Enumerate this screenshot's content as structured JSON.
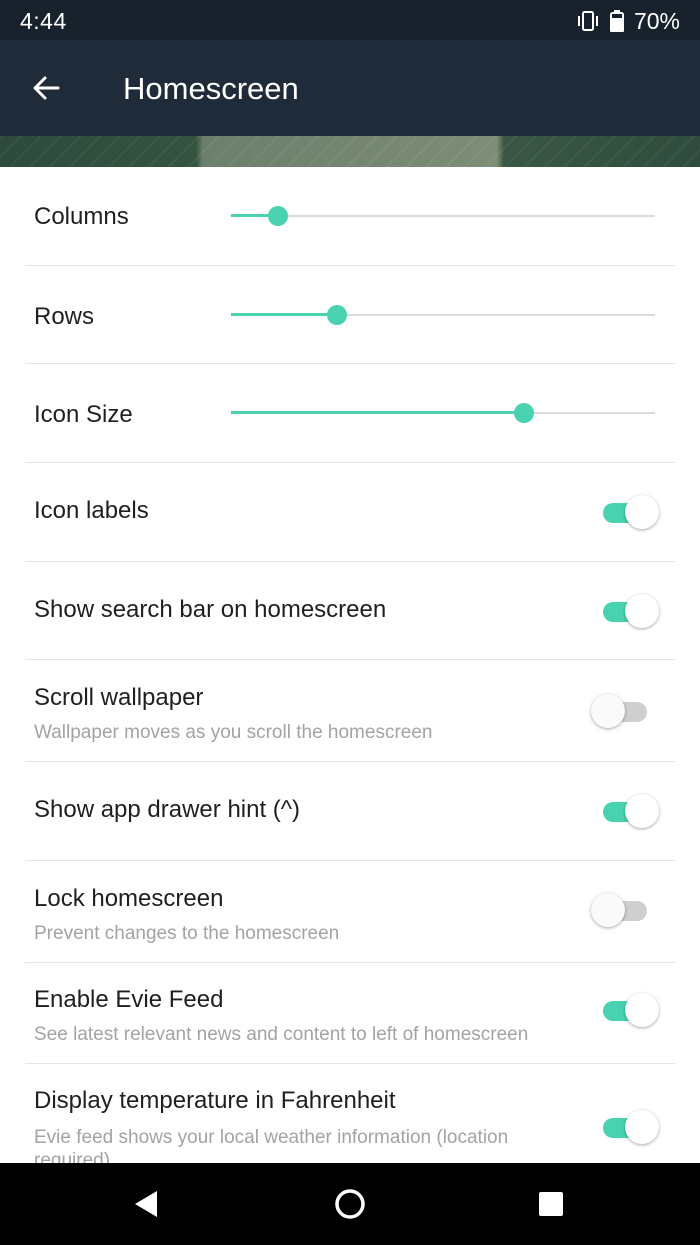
{
  "status_bar": {
    "time": "4:44",
    "battery": "70%",
    "icons": [
      "vibrate-icon",
      "battery-icon"
    ]
  },
  "app_bar": {
    "title": "Homescreen",
    "back_icon": "arrow-left-icon"
  },
  "colors": {
    "accent": "#48d2b0",
    "status_bar": "#18222d",
    "app_bar": "#1f2b38"
  },
  "settings": {
    "sliders": [
      {
        "label": "Columns",
        "value": 0.11
      },
      {
        "label": "Rows",
        "value": 0.25
      },
      {
        "label": "Icon Size",
        "value": 0.69
      }
    ],
    "toggles": [
      {
        "label": "Icon labels",
        "summary": "",
        "on": true
      },
      {
        "label": "Show search bar on homescreen",
        "summary": "",
        "on": true
      },
      {
        "label": "Scroll wallpaper",
        "summary": "Wallpaper moves as you scroll the homescreen",
        "on": false
      },
      {
        "label": "Show app drawer hint (^)",
        "summary": "",
        "on": true
      },
      {
        "label": "Lock homescreen",
        "summary": "Prevent changes to the homescreen",
        "on": false
      },
      {
        "label": "Enable Evie Feed",
        "summary": "See latest relevant news and content to left of homescreen",
        "on": true
      },
      {
        "label": "Display temperature in Fahrenheit",
        "summary": "Evie feed shows your local weather information (location required)",
        "on": true
      }
    ]
  },
  "nav_bar": {
    "buttons": [
      "back-triangle-icon",
      "home-circle-icon",
      "recents-square-icon"
    ]
  }
}
